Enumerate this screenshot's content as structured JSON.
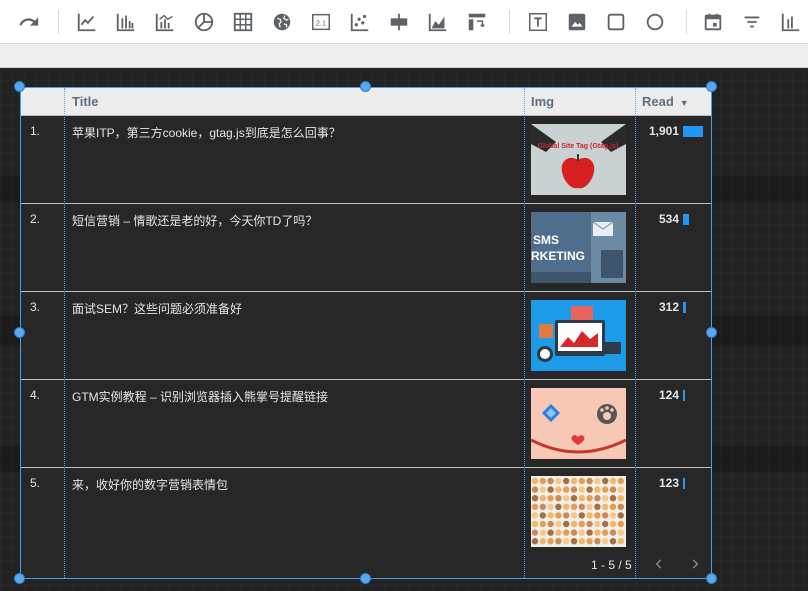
{
  "toolbar": {
    "items": [
      {
        "name": "redo-icon"
      },
      {
        "name": "time-series-chart-icon"
      },
      {
        "name": "bar-chart-icon"
      },
      {
        "name": "combo-chart-icon"
      },
      {
        "name": "pie-chart-icon"
      },
      {
        "name": "table-icon"
      },
      {
        "name": "geo-map-icon"
      },
      {
        "name": "scorecard-icon",
        "glyph": "2.1"
      },
      {
        "name": "scatter-chart-icon"
      },
      {
        "name": "bullet-chart-icon"
      },
      {
        "name": "area-chart-icon"
      },
      {
        "name": "pivot-table-icon"
      },
      {
        "name": "text-box-icon"
      },
      {
        "name": "image-icon"
      },
      {
        "name": "rectangle-icon"
      },
      {
        "name": "circle-icon"
      },
      {
        "name": "date-range-icon"
      },
      {
        "name": "filter-control-icon"
      },
      {
        "name": "bar-chart-icon-2"
      }
    ],
    "icon_color": "#5f6368"
  },
  "table": {
    "columns": {
      "title": "Title",
      "img": "Img",
      "read": "Read"
    },
    "sort": "descending",
    "rows": [
      {
        "num": "1.",
        "title": "苹果ITP，第三方cookie，gtag.js到底是怎么回事？",
        "read": "1,901",
        "read_value": 1901,
        "img_theme": "gtag-apple"
      },
      {
        "num": "2.",
        "title": "短信营销 – 情歌还是老的好，今天你TD了吗？",
        "read": "534",
        "read_value": 534,
        "img_theme": "sms-marketing"
      },
      {
        "num": "3.",
        "title": "面试SEM？这些问题必须准备好",
        "read": "312",
        "read_value": 312,
        "img_theme": "sem-dashboard"
      },
      {
        "num": "4.",
        "title": "GTM实例教程 – 识别浏览器插入熊掌号提醒链接",
        "read": "124",
        "read_value": 124,
        "img_theme": "gtm-bear-paw"
      },
      {
        "num": "5.",
        "title": "来，收好你的数字营销表情包",
        "read": "123",
        "read_value": 123,
        "img_theme": "emoji-pack"
      }
    ],
    "pager": {
      "text": "1 - 5 / 5"
    },
    "bar_color": "#2196f3",
    "selection_color": "#4a9fe8"
  },
  "img_text": {
    "gtag": "Global Site Tag (Gtag.js)",
    "sms1": "SMS",
    "sms2": "RKETING"
  }
}
